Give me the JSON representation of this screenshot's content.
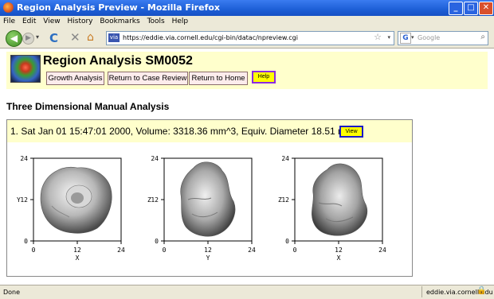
{
  "window": {
    "title": "Region Analysis Preview - Mozilla Firefox",
    "buttons": [
      "_",
      "□",
      "✕"
    ]
  },
  "menu": [
    "File",
    "Edit",
    "View",
    "History",
    "Bookmarks",
    "Tools",
    "Help"
  ],
  "nav": {
    "url": "https://eddie.via.cornell.edu/cgi-bin/datac/npreview.cgi",
    "search_placeholder": "Google",
    "search_engine": "G"
  },
  "icons": {
    "back": "◀",
    "fwd": "▶",
    "drop": "▾",
    "reload": "C",
    "stop": "✕",
    "home": "⌂",
    "star": "☆",
    "mag": "⌕",
    "lock": "🔒"
  },
  "header": {
    "title": "Region Analysis SM0052",
    "buttons": [
      "Growth Analysis",
      "Return to Case Review",
      "Return to Home"
    ],
    "help_label": "Help"
  },
  "section_title": "Three Dimensional Manual Analysis",
  "panel": {
    "heading": "1. Sat Jan 01 15:47:01 2000, Volume: 3318.36 mm^3, Equiv. Diameter 18.51 mm",
    "view_label": "View",
    "plots": [
      {
        "xlabel": "X",
        "ylabel": "Y",
        "x_ticks": [
          "0",
          "12",
          "24"
        ],
        "y_ticks": [
          "0",
          "12",
          "24"
        ]
      },
      {
        "xlabel": "Y",
        "ylabel": "Z",
        "x_ticks": [
          "0",
          "12",
          "24"
        ],
        "y_ticks": [
          "0",
          "12",
          "24"
        ]
      },
      {
        "xlabel": "X",
        "ylabel": "Z",
        "x_ticks": [
          "0",
          "12",
          "24"
        ],
        "y_ticks": [
          "0",
          "12",
          "24"
        ]
      }
    ]
  },
  "status": {
    "text": "Done",
    "host": "eddie.via.cornell.edu"
  }
}
